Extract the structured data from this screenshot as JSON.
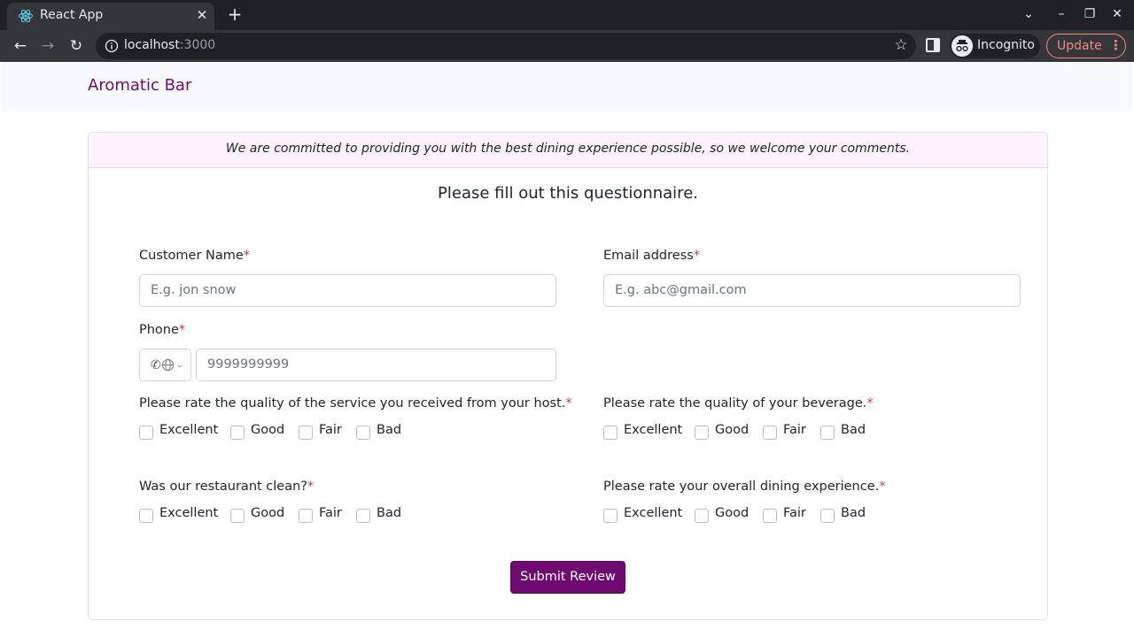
{
  "browser": {
    "tab_title": "React App",
    "url_host": "localhost",
    "url_port": ":3000",
    "profile_label": "Incognito",
    "update_label": "Update"
  },
  "app": {
    "brand": "Aromatic Bar",
    "brand_color": "#6f0a70"
  },
  "card": {
    "header": "We are committed to providing you with the best dining experience possible, so we welcome your comments.",
    "title": "Please fill out this questionnaire."
  },
  "form": {
    "required_mark": "*",
    "name": {
      "label": "Customer Name",
      "placeholder": "E.g. jon snow"
    },
    "email": {
      "label": "Email address",
      "placeholder": "E.g. abc@gmail.com"
    },
    "phone": {
      "label": "Phone",
      "placeholder": "9999999999"
    },
    "questions": [
      {
        "label": "Please rate the quality of the service you received from your host."
      },
      {
        "label": "Please rate the quality of your beverage."
      },
      {
        "label": "Was our restaurant clean?"
      },
      {
        "label": "Please rate your overall dining experience."
      }
    ],
    "options": [
      "Excellent",
      "Good",
      "Fair",
      "Bad"
    ],
    "submit_label": "Submit Review"
  }
}
